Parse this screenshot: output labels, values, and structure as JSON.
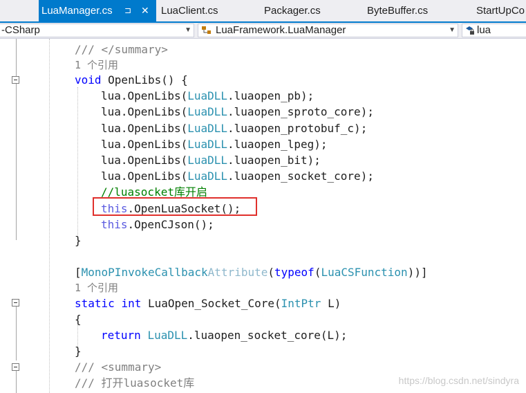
{
  "tabs": [
    {
      "label": "LuaManager.cs",
      "active": true
    },
    {
      "label": "LuaClient.cs"
    },
    {
      "label": "Packager.cs"
    },
    {
      "label": "ByteBuffer.cs"
    },
    {
      "label": "StartUpCo"
    }
  ],
  "tab_pin_glyph": "⊐",
  "tab_close_glyph": "✕",
  "nav": {
    "project": "-CSharp",
    "class": "LuaFramework.LuaManager",
    "member": "lua"
  },
  "code": {
    "l0": "/// </summary>",
    "l1": "1 个引用",
    "l2_kw": "void",
    "l2_rest": " OpenLibs() {",
    "l3_a": "lua.OpenLibs(",
    "l3_t": "LuaDLL",
    "l3_b": ".luaopen_pb);",
    "l4_a": "lua.OpenLibs(",
    "l4_t": "LuaDLL",
    "l4_b": ".luaopen_sproto_core);",
    "l5_a": "lua.OpenLibs(",
    "l5_t": "LuaDLL",
    "l5_b": ".luaopen_protobuf_c);",
    "l6_a": "lua.OpenLibs(",
    "l6_t": "LuaDLL",
    "l6_b": ".luaopen_lpeg);",
    "l7_a": "lua.OpenLibs(",
    "l7_t": "LuaDLL",
    "l7_b": ".luaopen_bit);",
    "l8_a": "lua.OpenLibs(",
    "l8_t": "LuaDLL",
    "l8_b": ".luaopen_socket_core);",
    "l9": "//luasocket库开启",
    "l10_kw": "this",
    "l10_rest": ".OpenLuaSocket();",
    "l11_kw": "this",
    "l11_rest": ".OpenCJson();",
    "l12": "}",
    "l14_a": "[",
    "l14_t": "MonoPInvokeCallback",
    "l14_g": "Attribute",
    "l14_b": "(",
    "l14_kw": "typeof",
    "l14_c": "(",
    "l14_t2": "LuaCSFunction",
    "l14_d": "))]",
    "l15": "1 个引用",
    "l16_kw1": "static",
    "l16_kw2": "int",
    "l16_a": " LuaOpen_Socket_Core(",
    "l16_t": "IntPtr",
    "l16_b": " L)",
    "l17": "{",
    "l18_kw": "return",
    "l18_t": "LuaDLL",
    "l18_b": ".luaopen_socket_core(L);",
    "l19": "}",
    "l20": "/// <summary>",
    "l21": "/// 打开luasocket库"
  },
  "watermark": "https://blog.csdn.net/sindyra",
  "colors": {
    "accent": "#007acc",
    "keyword": "#0000ff",
    "type": "#2b91af",
    "comment": "#008000",
    "highlight_box": "#e0302c"
  }
}
